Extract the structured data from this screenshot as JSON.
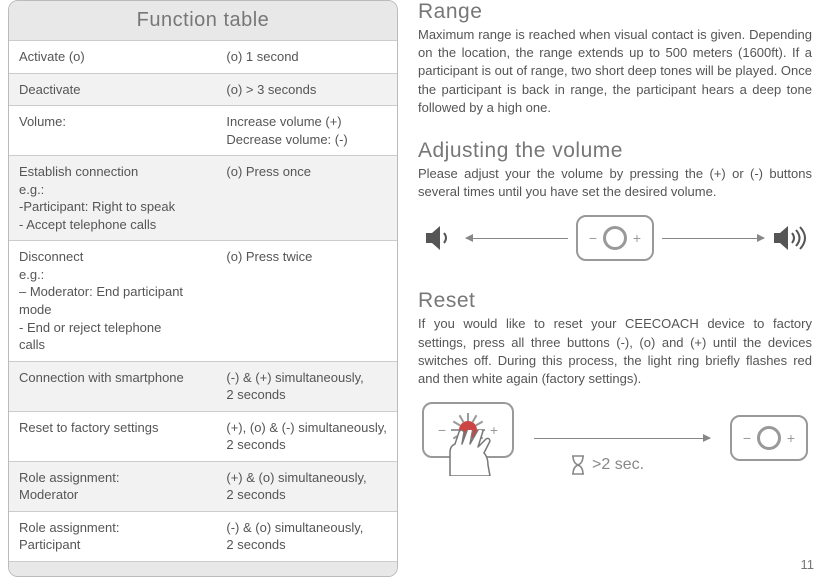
{
  "function_table": {
    "title": "Function table",
    "rows": [
      {
        "left": "Activate  (o)",
        "right": "(o) 1 second"
      },
      {
        "left": "Deactivate",
        "right": "(o) > 3 seconds"
      },
      {
        "left": "Volume:",
        "right": "Increase volume  (+)\nDecrease volume: (-)"
      },
      {
        "left": "Establish connection\ne.g.:\n -Participant: Right to speak\n- Accept telephone calls",
        "right": "(o) Press once"
      },
      {
        "left": "Disconnect\n e.g.:\n – Moderator: End participant\n     mode\n-  End or reject telephone\n    calls",
        "right": "(o)  Press twice"
      },
      {
        "left": "Connection with smartphone",
        "right": "(-) & (+) simultaneously,\n2 seconds"
      },
      {
        "left": "Reset to factory settings",
        "right": "(+), (o) &  (-) simultaneously,\n2 seconds"
      },
      {
        "left": "Role assignment:\nModerator",
        "right": "(+) & (o) simultaneously,\n2 seconds"
      },
      {
        "left": "Role assignment:\nParticipant",
        "right": "(-)  & (o) simultaneously,\n2 seconds"
      }
    ]
  },
  "sections": {
    "range": {
      "title": "Range",
      "body": "Maximum range is reached when visual contact is given. Depending on the location, the range extends up to 500 meters (1600ft). If a participant is out of range, two short deep tones will be played. Once the participant is back in range, the participant hears a deep tone followed by a high one."
    },
    "volume": {
      "title": "Adjusting the volume",
      "body": "Please adjust your the volume by pressing the (+) or (-) buttons several times until you have set the desired volume."
    },
    "reset": {
      "title": "Reset",
      "body": "If you would like to reset your CEECOACH device to factory settings, press all three buttons (-), (o) and (+) until the devices switches off. During this process, the light ring briefly flashes red and then white again (factory settings).",
      "hourglass_label": ">2 sec."
    }
  },
  "device": {
    "minus": "−",
    "plus": "+"
  },
  "page_number": "11"
}
